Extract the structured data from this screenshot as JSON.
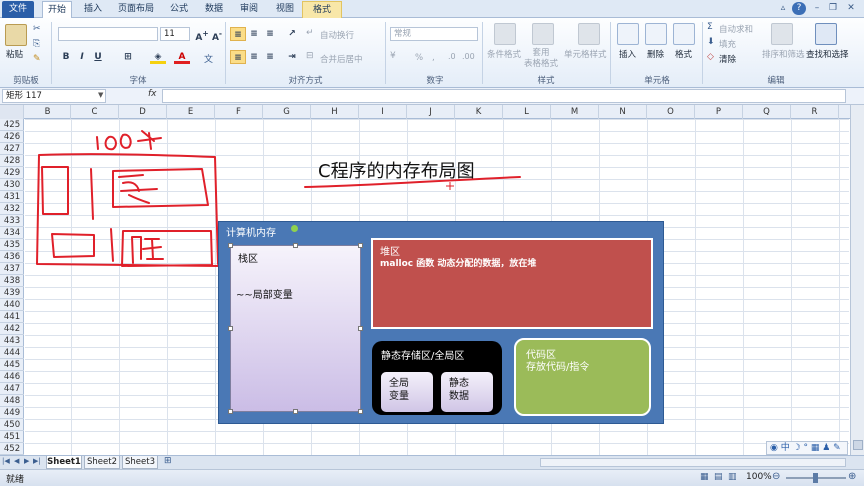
{
  "tabs": [
    {
      "label": "文件",
      "kind": "file"
    },
    {
      "label": "开始",
      "kind": "active"
    },
    {
      "label": "插入",
      "kind": ""
    },
    {
      "label": "页面布局",
      "kind": ""
    },
    {
      "label": "公式",
      "kind": ""
    },
    {
      "label": "数据",
      "kind": ""
    },
    {
      "label": "审阅",
      "kind": ""
    },
    {
      "label": "视图",
      "kind": ""
    },
    {
      "label": "格式",
      "kind": "fmt"
    }
  ],
  "ribbon": {
    "clipboard": {
      "paste": "粘贴",
      "group": "剪贴板"
    },
    "font": {
      "name": "",
      "size": "11",
      "group": "字体"
    },
    "alignment": {
      "wrap": "自动换行",
      "merge": "合并后居中",
      "group": "对齐方式"
    },
    "number": {
      "format": "常规",
      "percent": "%",
      "comma": ",",
      "group": "数字"
    },
    "styles": {
      "conditional": "条件格式",
      "table": "套用\n表格格式",
      "cell_styles": "单元格样式",
      "group": "样式"
    },
    "cells": {
      "insert": "插入",
      "delete": "删除",
      "format": "格式",
      "group": "单元格"
    },
    "editing": {
      "autosum": "自动求和",
      "fill": "填充",
      "clear": "清除",
      "sort": "排序和筛选",
      "find": "查找和选择",
      "group": "编辑"
    }
  },
  "formula_bar": {
    "name_box": "矩形 117",
    "fx": "fx",
    "value": ""
  },
  "columns": [
    "B",
    "C",
    "D",
    "E",
    "F",
    "G",
    "H",
    "I",
    "J",
    "K",
    "L",
    "M",
    "N",
    "O",
    "P",
    "Q",
    "R"
  ],
  "rows": [
    "425",
    "426",
    "427",
    "428",
    "429",
    "430",
    "431",
    "432",
    "433",
    "434",
    "435",
    "436",
    "437",
    "438",
    "439",
    "440",
    "441",
    "442",
    "443",
    "444",
    "445",
    "446",
    "447",
    "448",
    "449",
    "450",
    "451",
    "452"
  ],
  "sheets": [
    "Sheet1",
    "Sheet2",
    "Sheet3"
  ],
  "status": {
    "left": "就绪",
    "zoom": "100%"
  },
  "diagram": {
    "title": "C程序的内存布局图",
    "computer_memory": "计算机内存",
    "stack": {
      "title": "栈区",
      "desc": "~~局部变量"
    },
    "heap": {
      "title": "堆区",
      "desc": "malloc 函数 动态分配的数据，放在堆"
    },
    "static": {
      "title": "静态存储区/全局区",
      "global": "全局\n变量",
      "static_data": "静态\n数据"
    },
    "code": {
      "title": "代码区",
      "desc": "存放代码/指令"
    }
  },
  "colors": {
    "memory": "#4a78b5",
    "heap": "#c0504d",
    "code": "#9bbb59",
    "static": "#000000",
    "handwriting": "#e0202a"
  }
}
